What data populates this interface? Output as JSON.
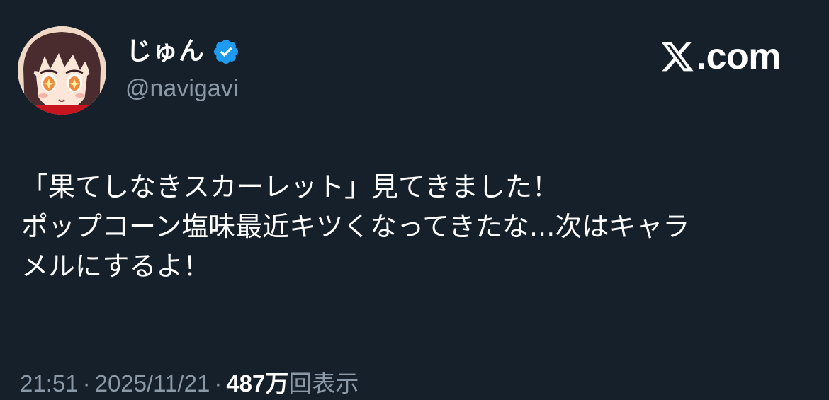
{
  "author": {
    "display_name": "じゅん",
    "handle": "@navigavi",
    "verified": true,
    "avatar_icon": "anime-girl-avatar"
  },
  "site": {
    "domain": ".com",
    "logo_icon": "x-logo-icon"
  },
  "tweet": {
    "lines": [
      "「果てしなきスカーレット」見てきました！",
      "ポップコーン塩味最近キツくなってきたな...次はキャラ",
      "メルにするよ！"
    ]
  },
  "meta": {
    "time": "21:51",
    "separator": "·",
    "date": "2025/11/21",
    "views_count": "487万",
    "views_label": "回表示"
  },
  "colors": {
    "background": "#15202b",
    "text_primary": "#ffffff",
    "text_secondary": "#8b98a5",
    "verified_blue": "#1d9bf0"
  }
}
